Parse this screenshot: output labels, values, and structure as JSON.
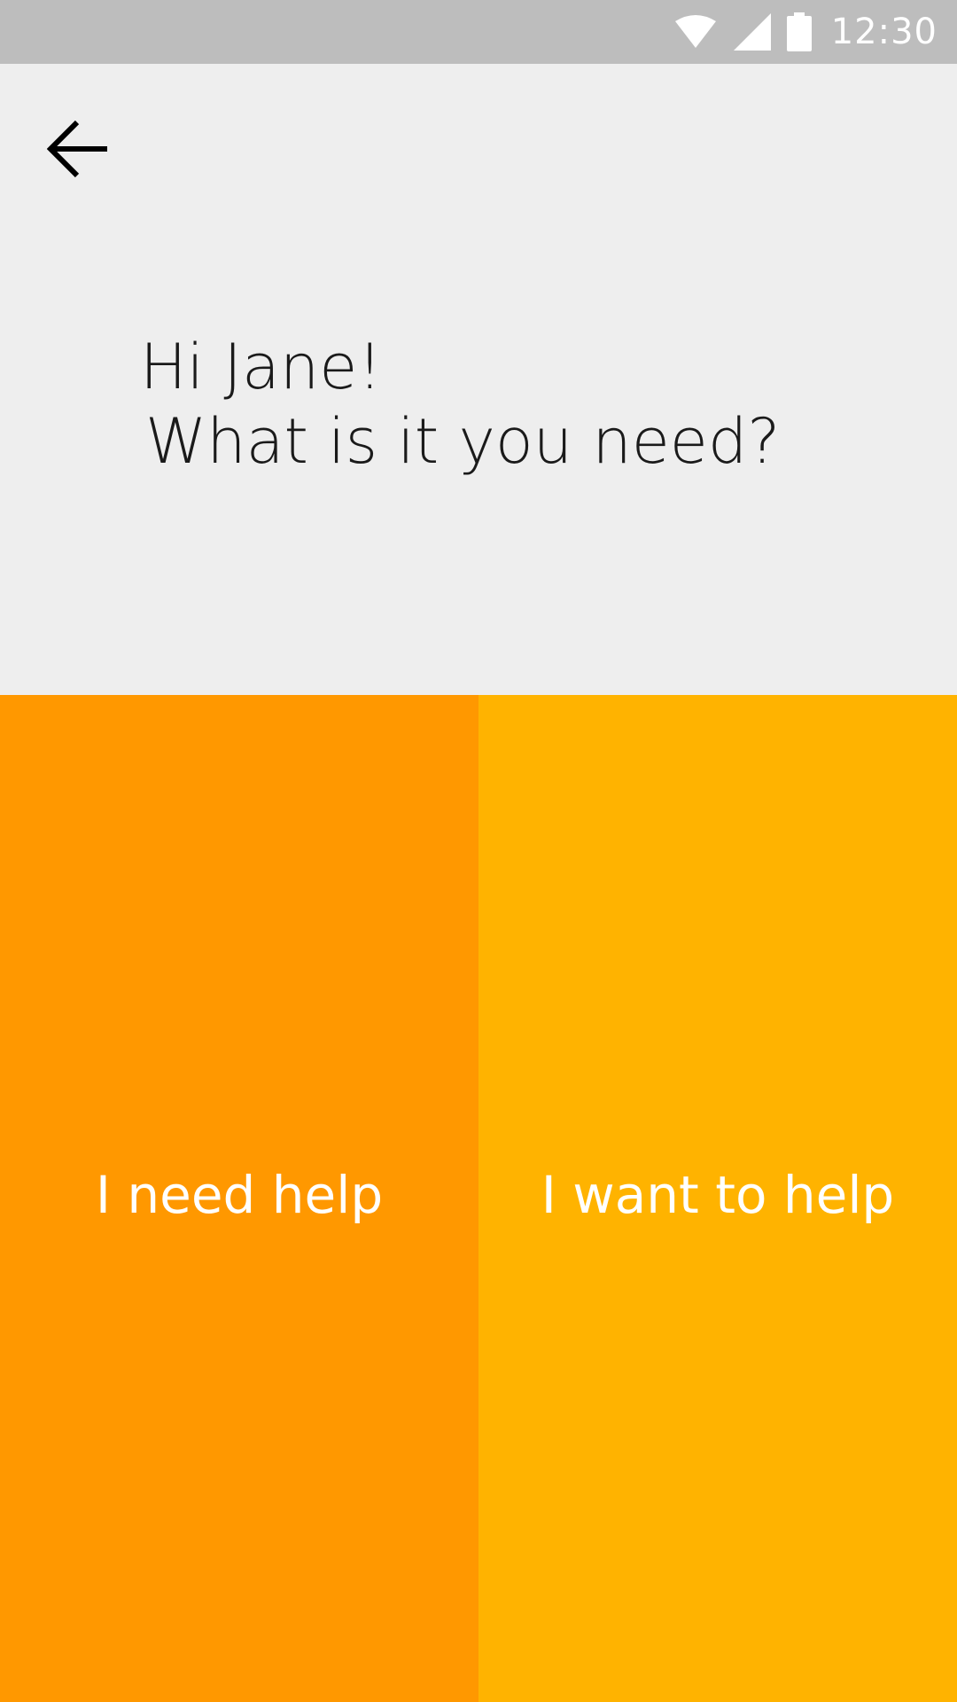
{
  "status_bar": {
    "time": "12:30",
    "icons": [
      "wifi-icon",
      "cell-signal-icon",
      "battery-icon"
    ]
  },
  "header": {
    "back_icon": "arrow-left-icon",
    "greeting_line1": "Hi Jane!",
    "greeting_line2": "What is it you need?"
  },
  "choices": {
    "need_help": {
      "label": "I need help",
      "color": "#ff9800"
    },
    "want_to_help": {
      "label": "I want to help",
      "color": "#ffb300"
    }
  },
  "colors": {
    "status_bar": "#bdbdbd",
    "background": "#eeeeee"
  }
}
